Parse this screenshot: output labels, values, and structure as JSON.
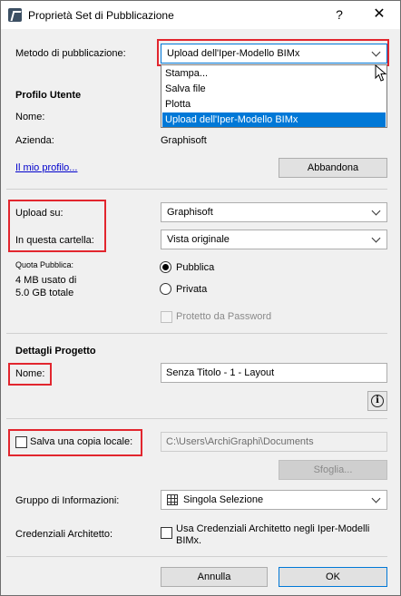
{
  "window": {
    "title": "Proprietà Set di Pubblicazione",
    "help_glyph": "?",
    "close_glyph": "✕"
  },
  "method": {
    "label": "Metodo di pubblicazione:",
    "value": "Upload dell'Iper-Modello BIMx",
    "options": [
      "Stampa...",
      "Salva file",
      "Plotta",
      "Upload dell'Iper-Modello BIMx"
    ],
    "selected_index": 3
  },
  "profile": {
    "heading": "Profilo Utente",
    "name_label": "Nome:",
    "company_label": "Azienda:",
    "company_value": "Graphisoft",
    "my_profile_link": "Il mio profilo...",
    "leave_button": "Abbandona"
  },
  "upload": {
    "upload_on_label": "Upload su:",
    "upload_on_value": "Graphisoft",
    "folder_label": "In questa cartella:",
    "folder_value": "Vista originale",
    "quota_label": "Quota Pubblica:",
    "quota_line1": "4 MB usato di",
    "quota_line2": "5.0 GB totale",
    "public_label": "Pubblica",
    "private_label": "Privata",
    "visibility": "Pubblica",
    "password_label": "Protetto da Password",
    "password_checked": false
  },
  "project": {
    "heading": "Dettagli Progetto",
    "name_label": "Nome:",
    "name_value": "Senza Titolo - 1 - Layout",
    "info_glyph": "i"
  },
  "local_copy": {
    "label": "Salva una copia locale:",
    "checked": false,
    "path": "C:\\Users\\ArchiGraphi\\Documents",
    "browse_button": "Sfoglia..."
  },
  "info_group": {
    "label": "Gruppo di Informazioni:",
    "value": "Singola Selezione"
  },
  "architect": {
    "label": "Credenziali Architetto:",
    "checkbox_line1": "Usa Credenziali Architetto negli Iper-Modelli",
    "checkbox_line2": "BIMx.",
    "checked": false
  },
  "footer": {
    "cancel_button": "Annulla",
    "ok_button": "OK"
  },
  "colors": {
    "highlight_box": "#e2262e",
    "selection": "#0078d7",
    "link": "#0000cc"
  }
}
